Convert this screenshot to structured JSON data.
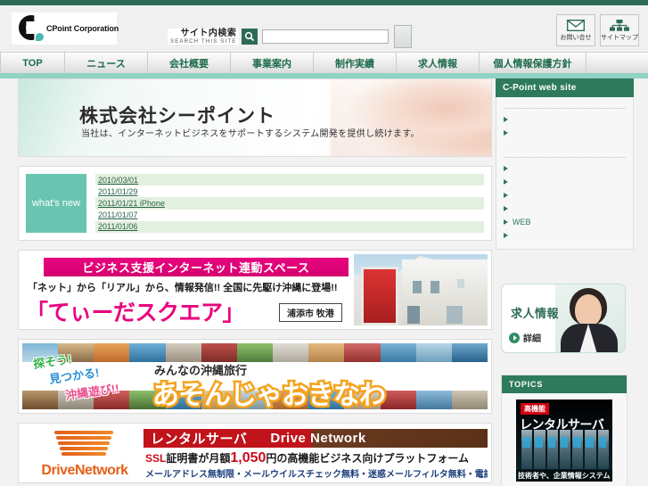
{
  "site": {
    "logo_text": "CPoint Corporation",
    "company_name": "株式会社シーポイント"
  },
  "header": {
    "search_label_jp": "サイト内検索",
    "search_label_en": "SEARCH THIS SITE",
    "search_placeholder": "",
    "search_value": "",
    "buttons": [
      {
        "label": "お問い合せ",
        "icon": "envelope-icon"
      },
      {
        "label": "サイトマップ",
        "icon": "sitemap-icon"
      }
    ]
  },
  "nav": {
    "items": [
      {
        "label": "TOP",
        "active": true
      },
      {
        "label": "ニュース",
        "active": false
      },
      {
        "label": "会社概要",
        "active": false
      },
      {
        "label": "事業案内",
        "active": false
      },
      {
        "label": "制作実績",
        "active": false
      },
      {
        "label": "求人情報",
        "active": false
      },
      {
        "label": "個人情報保護方針",
        "active": false
      }
    ]
  },
  "hero": {
    "title": "株式会社シーポイント",
    "subtitle": "当社は、インターネットビジネスをサポートするシステム開発を提供し続けます。"
  },
  "whats_new": {
    "badge": "what's new",
    "items": [
      {
        "label": "2010/03/01"
      },
      {
        "label": "2011/01/29"
      },
      {
        "label": "2011/01/21 iPhone"
      },
      {
        "label": "2011/01/07"
      },
      {
        "label": "2011/01/06"
      }
    ]
  },
  "banner_tiida": {
    "headline": "ビジネス支援インターネット連動スペース",
    "lead": "「ネット」から「リアル」から、情報発信!! 全国に先駆け沖縄に登場!!",
    "title": "「てぃーだスクエア」",
    "location": "浦添市 牧港"
  },
  "banner_okinawa": {
    "line1": "探そう!",
    "line2": "見つかる!",
    "line3": "沖縄遊び!!",
    "small": "みんなの沖縄旅行",
    "big": "あそんじゃおきなわ"
  },
  "banner_drive": {
    "logo_text": "DriveNetwork",
    "head_jp": "レンタルサーバ",
    "head_en": "Drive Network",
    "line2_a": "SSL",
    "line2_b": "証明書が月額",
    "line2_price": "1,050",
    "line2_c": "円の高機能ビジネス向けプラットフォーム",
    "line3": "メールアドレス無制限・メールウイルスチェック無料・迷惑メールフィルタ無料・電話サポート無料"
  },
  "sidebar": {
    "panel_title": "C-Point web site",
    "group1": [
      {
        "label": ""
      },
      {
        "label": ""
      }
    ],
    "group2": [
      {
        "label": ""
      },
      {
        "label": ""
      },
      {
        "label": ""
      },
      {
        "label": ""
      },
      {
        "label": "WEB"
      },
      {
        "label": ""
      }
    ]
  },
  "recruit": {
    "title": "求人情報",
    "more_label": "詳細"
  },
  "topics": {
    "panel_title": "TOPICS",
    "badge": "高機能",
    "title": "レンタルサーバ",
    "caption": "技術者や、企業情報システム"
  },
  "colors": {
    "brand_green": "#2e7a5d",
    "accent_teal": "#8fd3c2",
    "pink": "#e8047f",
    "orange": "#e4601a",
    "red": "#c0131a"
  }
}
